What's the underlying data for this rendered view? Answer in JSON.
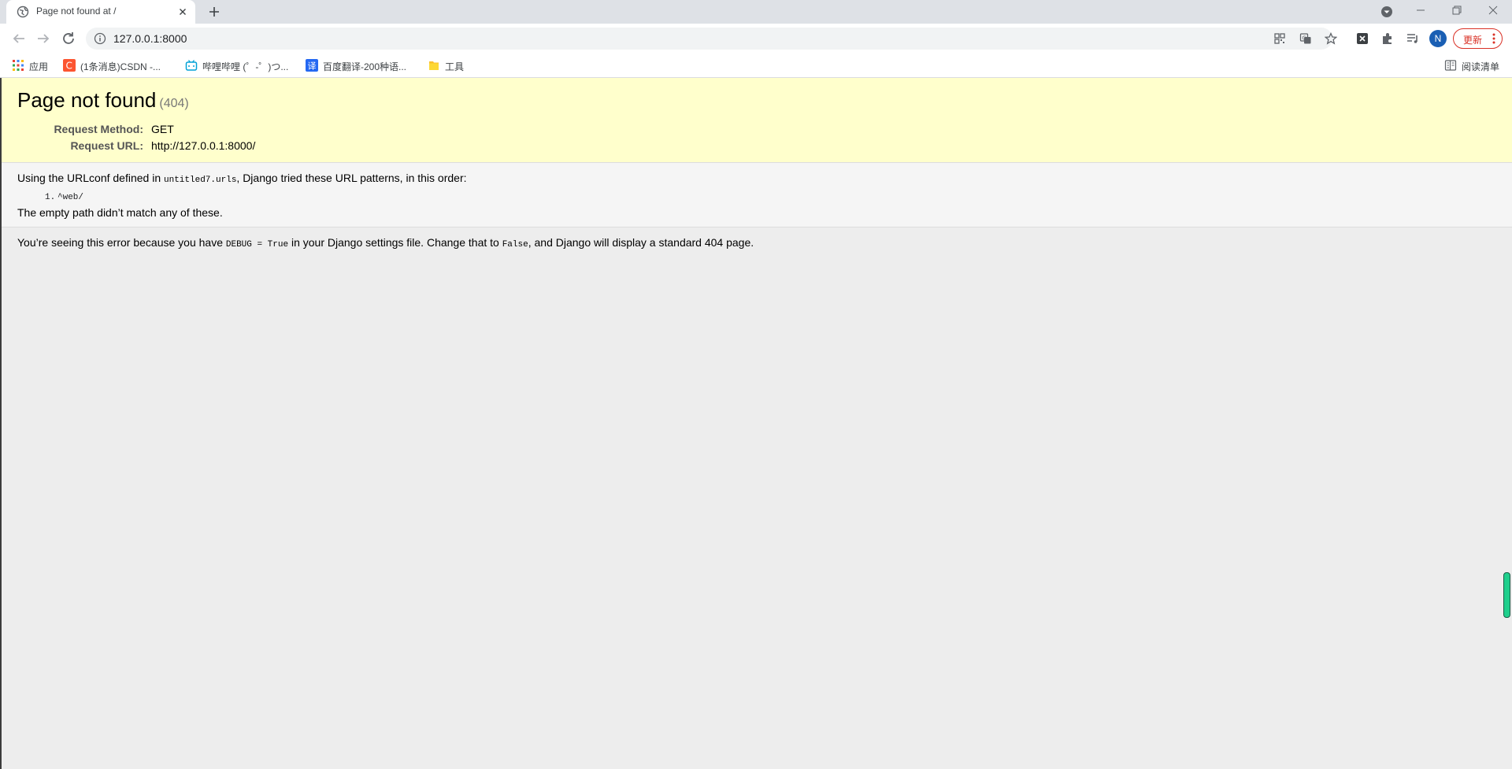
{
  "tab": {
    "title": "Page not found at /",
    "favicon": "globe-icon"
  },
  "toolbar": {
    "url": "127.0.0.1:8000",
    "avatar_letter": "N",
    "update_label": "更新"
  },
  "bookmarks": {
    "items": [
      {
        "label": "应用",
        "icon": "apps-grid-icon"
      },
      {
        "label": "(1条消息)CSDN -...",
        "icon": "csdn-icon"
      },
      {
        "label": "哔哩哔哩 (゜-゜)つ...",
        "icon": "bilibili-icon"
      },
      {
        "label": "百度翻译-200种语...",
        "icon": "baidu-translate-icon"
      },
      {
        "label": "工具",
        "icon": "folder-icon"
      }
    ],
    "reading_list": "阅读清单"
  },
  "error": {
    "heading": "Page not found",
    "status": "(404)",
    "request_method_label": "Request Method:",
    "request_method": "GET",
    "request_url_label": "Request URL:",
    "request_url": "http://127.0.0.1:8000/",
    "urlconf_prefix": "Using the URLconf defined in ",
    "urlconf_module": "untitled7.urls",
    "urlconf_suffix": ", Django tried these URL patterns, in this order:",
    "patterns": [
      {
        "index": "1.",
        "pattern": "^web/"
      }
    ],
    "no_match": "The empty path didn’t match any of these.",
    "explanation_1": "You’re seeing this error because you have ",
    "debug_setting": "DEBUG = True",
    "explanation_2": " in your Django settings file. Change that to ",
    "false_value": "False",
    "explanation_3": ", and Django will display a standard 404 page."
  },
  "colors": {
    "summary_bg": "#ffffcc",
    "info_bg": "#f5f5f5",
    "page_bg": "#ededed",
    "update_red": "#d93025",
    "avatar_blue": "#1a5fb4"
  }
}
